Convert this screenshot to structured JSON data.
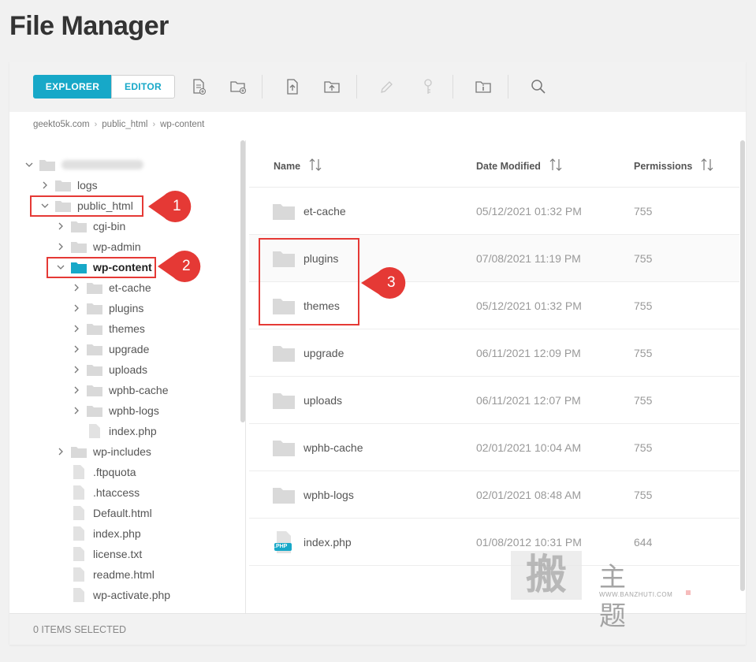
{
  "page": {
    "title": "File Manager"
  },
  "toolbar": {
    "explorer_label": "EXPLORER",
    "editor_label": "EDITOR",
    "icons": [
      "new-file-icon",
      "new-folder-icon",
      "upload-file-icon",
      "upload-folder-icon",
      "rename-icon",
      "permissions-icon",
      "info-icon",
      "search-icon"
    ]
  },
  "breadcrumb": [
    "geekto5k.com",
    "public_html",
    "wp-content"
  ],
  "tree": {
    "root_label": "",
    "items": [
      {
        "label": "logs",
        "type": "folder",
        "depth": 1,
        "expanded": false
      },
      {
        "label": "public_html",
        "type": "folder",
        "depth": 1,
        "expanded": true
      },
      {
        "label": "cgi-bin",
        "type": "folder",
        "depth": 2,
        "expanded": false
      },
      {
        "label": "wp-admin",
        "type": "folder",
        "depth": 2,
        "expanded": false
      },
      {
        "label": "wp-content",
        "type": "folder",
        "depth": 2,
        "expanded": true,
        "selected": true
      },
      {
        "label": "et-cache",
        "type": "folder",
        "depth": 3,
        "expanded": false
      },
      {
        "label": "plugins",
        "type": "folder",
        "depth": 3,
        "expanded": false
      },
      {
        "label": "themes",
        "type": "folder",
        "depth": 3,
        "expanded": false
      },
      {
        "label": "upgrade",
        "type": "folder",
        "depth": 3,
        "expanded": false
      },
      {
        "label": "uploads",
        "type": "folder",
        "depth": 3,
        "expanded": false
      },
      {
        "label": "wphb-cache",
        "type": "folder",
        "depth": 3,
        "expanded": false
      },
      {
        "label": "wphb-logs",
        "type": "folder",
        "depth": 3,
        "expanded": false
      },
      {
        "label": "index.php",
        "type": "file",
        "depth": 3
      },
      {
        "label": "wp-includes",
        "type": "folder",
        "depth": 2,
        "expanded": false
      },
      {
        "label": ".ftpquota",
        "type": "file",
        "depth": 2
      },
      {
        "label": ".htaccess",
        "type": "file",
        "depth": 2
      },
      {
        "label": "Default.html",
        "type": "file",
        "depth": 2
      },
      {
        "label": "index.php",
        "type": "file",
        "depth": 2
      },
      {
        "label": "license.txt",
        "type": "file",
        "depth": 2
      },
      {
        "label": "readme.html",
        "type": "file",
        "depth": 2
      },
      {
        "label": "wp-activate.php",
        "type": "file",
        "depth": 2
      }
    ]
  },
  "list": {
    "columns": [
      "Name",
      "Date Modified",
      "Permissions"
    ],
    "rows": [
      {
        "name": "et-cache",
        "date": "05/12/2021 01:32 PM",
        "perm": "755",
        "type": "folder"
      },
      {
        "name": "plugins",
        "date": "07/08/2021 11:19 PM",
        "perm": "755",
        "type": "folder"
      },
      {
        "name": "themes",
        "date": "05/12/2021 01:32 PM",
        "perm": "755",
        "type": "folder"
      },
      {
        "name": "upgrade",
        "date": "06/11/2021 12:09 PM",
        "perm": "755",
        "type": "folder"
      },
      {
        "name": "uploads",
        "date": "06/11/2021 12:07 PM",
        "perm": "755",
        "type": "folder"
      },
      {
        "name": "wphb-cache",
        "date": "02/01/2021 10:04 AM",
        "perm": "755",
        "type": "folder"
      },
      {
        "name": "wphb-logs",
        "date": "02/01/2021 08:48 AM",
        "perm": "755",
        "type": "folder"
      },
      {
        "name": "index.php",
        "date": "01/08/2012 10:31 PM",
        "perm": "644",
        "type": "php"
      }
    ],
    "php_badge": ".PHP"
  },
  "footer": {
    "status": "0 ITEMS SELECTED"
  },
  "annotations": [
    "1",
    "2",
    "3"
  ],
  "watermark": {
    "glyphs": "主 题",
    "url": "WWW.BANZHUTI.COM"
  },
  "colors": {
    "accent": "#17a8c8",
    "highlight": "#e53935",
    "folder": "#d9d9d9"
  }
}
